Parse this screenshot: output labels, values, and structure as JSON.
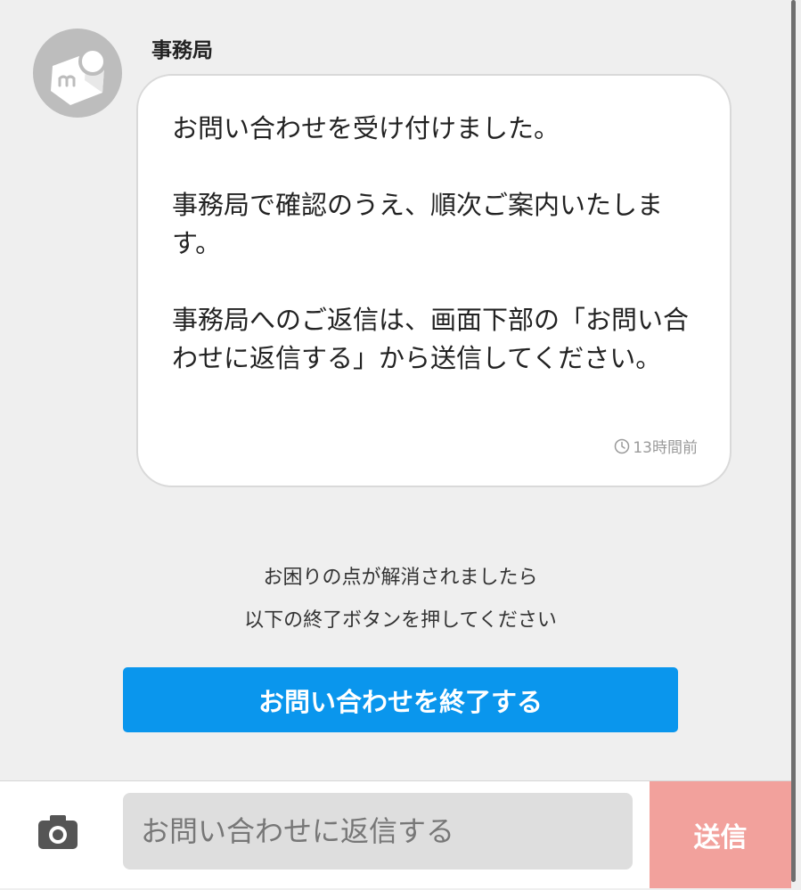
{
  "message": {
    "sender": "事務局",
    "paragraphs": [
      "お問い合わせを受け付けました。",
      "事務局で確認のうえ、順次ご案内いたします。",
      "事務局へのご返信は、画面下部の「お問い合わせに返信する」から送信してください。"
    ],
    "timestamp": "13時間前"
  },
  "notice": {
    "line1": "お困りの点が解消されましたら",
    "line2": "以下の終了ボタンを押してください"
  },
  "end_button_label": "お問い合わせを終了する",
  "composer": {
    "placeholder": "お問い合わせに返信する",
    "send_label": "送信"
  },
  "colors": {
    "accent": "#0a96ed",
    "send": "#f2a19c",
    "background": "#efefef"
  },
  "icons": {
    "avatar": "mercari-logo-icon",
    "timestamp": "clock-icon",
    "attach": "camera-icon"
  }
}
